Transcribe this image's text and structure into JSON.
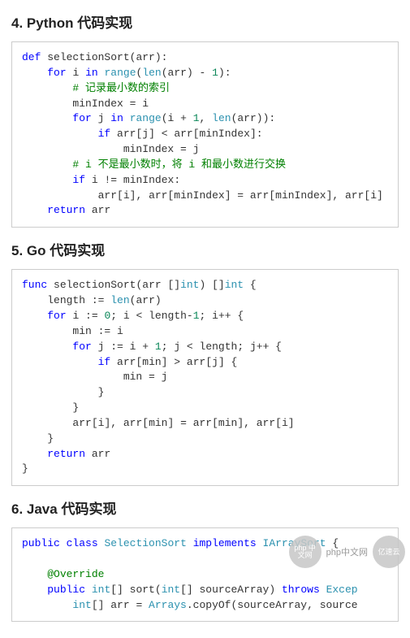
{
  "sections": {
    "python": {
      "title": "4. Python 代码实现"
    },
    "go": {
      "title": "5. Go 代码实现"
    },
    "java": {
      "title": "6. Java 代码实现"
    }
  },
  "code": {
    "python": {
      "kw_def": "def",
      "fn": "selectionSort",
      "arr": "arr",
      "kw_for": "for",
      "kw_in": "in",
      "range": "range",
      "len": "len",
      "minus1": "1",
      "cm1": "# 记录最小数的索引",
      "minIndex": "minIndex",
      "i": "i",
      "j": "j",
      "plus1": "1",
      "kw_if": "if",
      "lt": "<",
      "cm2": "# i 不是最小数时，将 i 和最小数进行交换",
      "ne": "!=",
      "kw_return": "return"
    },
    "go": {
      "kw_func": "func",
      "fn": "selectionSort",
      "arr": "arr",
      "int": "int",
      "length": "length",
      "len": "len",
      "kw_for": "for",
      "i": "i",
      "zero": "0",
      "one": "1",
      "min": "min",
      "j": "j",
      "kw_if": "if",
      "gt": ">",
      "kw_return": "return"
    },
    "java": {
      "kw_public": "public",
      "kw_class": "class",
      "cls": "SelectionSort",
      "kw_implements": "implements",
      "iface": "IArraySort",
      "ann": "@Override",
      "int": "int",
      "sort": "sort",
      "sourceArray": "sourceArray",
      "kw_throws": "throws",
      "Excep": "Excep",
      "arr": "arr",
      "Arrays": "Arrays",
      "copyOf": "copyOf",
      "source": "source"
    }
  },
  "watermark": {
    "circle1": "php 中文网",
    "circle2": "亿速云",
    "text": "php中文网"
  }
}
